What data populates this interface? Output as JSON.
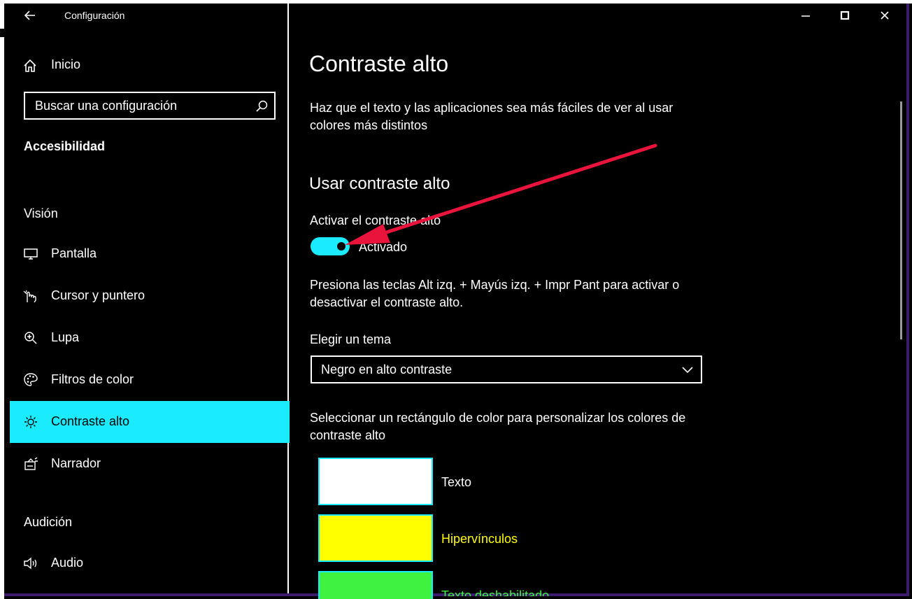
{
  "colors": {
    "accent": "#1aebff",
    "background": "#000000",
    "foreground": "#ffffff",
    "annotation_arrow": "#e8143c",
    "swatch_text": "#ffffff",
    "swatch_hyperlinks": "#ffff00",
    "swatch_disabled": "#3ff23f"
  },
  "window": {
    "title": "Configuración",
    "back_icon": "arrow-left-icon",
    "controls": [
      "minimize-icon",
      "maximize-icon",
      "close-icon"
    ]
  },
  "sidebar": {
    "home_label": "Inicio",
    "home_icon": "home-icon",
    "search_placeholder": "Buscar una configuración",
    "search_icon": "search-icon",
    "category": "Accesibilidad",
    "sections": [
      {
        "header": "Visión",
        "items": [
          {
            "label": "Pantalla",
            "icon": "monitor-icon",
            "selected": false
          },
          {
            "label": "Cursor y puntero",
            "icon": "cursor-icon",
            "selected": false
          },
          {
            "label": "Lupa",
            "icon": "magnifier-icon",
            "selected": false
          },
          {
            "label": "Filtros de color",
            "icon": "palette-icon",
            "selected": false
          },
          {
            "label": "Contraste alto",
            "icon": "sun-icon",
            "selected": true
          },
          {
            "label": "Narrador",
            "icon": "narrator-icon",
            "selected": false
          }
        ]
      },
      {
        "header": "Audición",
        "items": [
          {
            "label": "Audio",
            "icon": "speaker-icon",
            "selected": false
          }
        ]
      }
    ]
  },
  "main": {
    "title": "Contraste alto",
    "description": "Haz que el texto y las aplicaciones sea más fáciles de ver al usar colores más distintos",
    "section_title": "Usar contraste alto",
    "toggle_label": "Activar el contraste alto",
    "toggle_state": "Activado",
    "toggle_on": true,
    "shortcut_hint": "Presiona las teclas Alt izq. + Mayús izq. + Impr Pant para activar o desactivar el contraste alto.",
    "theme_label": "Elegir un tema",
    "theme_value": "Negro en alto contraste",
    "swatch_description": "Seleccionar un rectángulo de color para personalizar los colores de contraste alto",
    "swatches": [
      {
        "label": "Texto",
        "color": "#ffffff",
        "label_color": "#ffffff"
      },
      {
        "label": "Hipervínculos",
        "color": "#ffff00",
        "label_color": "#ffff00"
      },
      {
        "label": "Texto deshabilitado",
        "color": "#3ff23f",
        "label_color": "#3ff23f"
      }
    ]
  }
}
